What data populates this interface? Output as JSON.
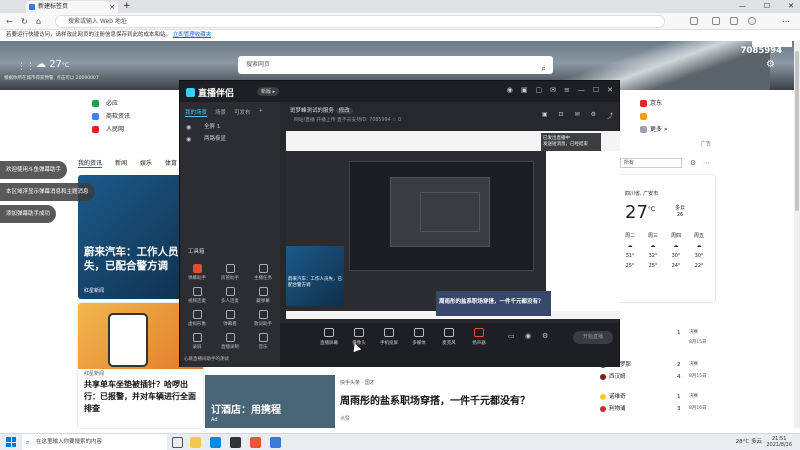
{
  "browser": {
    "tab_title": "新建标签页",
    "url_placeholder": "搜索或输入 Web 地址",
    "info_text": "若要运行快捷访问，请样改此网页的注册信息保存到此的成本和站。",
    "info_link": "立即管理收藏夹"
  },
  "hero": {
    "temp": "27",
    "temp_unit": "°C",
    "weather_sub": "根据你所在城市得获预警, 点击可以 20090007",
    "search_placeholder": "搜索网页",
    "count": "7085994"
  },
  "quick_links_left": [
    {
      "label": "必应",
      "color": "#16a34a"
    },
    {
      "label": "商软资讯",
      "color": "#3b82f6"
    },
    {
      "label": "人民网",
      "color": "#dc2626"
    }
  ],
  "quick_links_right": [
    {
      "label": "京东",
      "color": "#dc2626"
    },
    {
      "label": "",
      "color": "#f59e0b"
    },
    {
      "label": "更多 »",
      "color": "#9ca3af"
    }
  ],
  "ad_tag": "广告",
  "feed": {
    "tabs": [
      "我的资讯",
      "新闻",
      "娱乐",
      "体育"
    ],
    "card1_title": "蔚来汽车：工作人员失，已配合警方调",
    "card1_source": "红星新闻",
    "card2_source": "红星新闻",
    "card2_title": "共享单车坐垫被插针？哈啰出行：已报警，并对车辆进行全面排查",
    "card3_title": "订酒店：用携程",
    "card3_source": "Ad",
    "card4_source": "快手头条 · 国才",
    "card4_title": "周雨彤的盐系职场穿搭，一件千元都没有？",
    "card4_likes": "点赞"
  },
  "toasts": [
    "欢迎使用斗鱼弹幕助手",
    "本区域浮显示弹幕消息和主题消息",
    "添加弹幕助手成功"
  ],
  "weather_widget": {
    "location": "四川省, 广安市",
    "temp": "27",
    "unit": "°C",
    "cond": "多云",
    "aqi": "26",
    "forecast": [
      {
        "day": "周二",
        "hi": "31°",
        "lo": "25°"
      },
      {
        "day": "周三",
        "hi": "32°",
        "lo": "25°"
      },
      {
        "day": "周四",
        "hi": "30°",
        "lo": "24°"
      },
      {
        "day": "周五",
        "hi": "30°",
        "lo": "22°"
      }
    ],
    "select": "所有"
  },
  "sports": [
    {
      "team": "",
      "score": "1",
      "meta": "决赛",
      "color": "#3b82f6"
    },
    {
      "team": "",
      "score": "",
      "meta": "8月15日",
      "color": "#9ca3af"
    },
    {
      "team": "巴萨罗那",
      "score": "2",
      "meta": "决赛",
      "color": "#be123c"
    },
    {
      "team": "西汉姆",
      "score": "4",
      "meta": "8月15日",
      "color": "#7f1d1d"
    },
    {
      "team": "诺维奇",
      "score": "1",
      "meta": "决赛",
      "color": "#facc15"
    },
    {
      "team": "利物浦",
      "score": "3",
      "meta": "8月16日",
      "color": "#dc2626"
    }
  ],
  "app": {
    "name": "直播伴侣",
    "version": "新版 ▸",
    "scene_tabs": [
      "我的场景",
      "场景",
      "可发布"
    ],
    "scenes": [
      "全屏 1",
      "两路极显"
    ],
    "tools_label": "工具箱",
    "tools": [
      "弹幕助手",
      "房管助手",
      "主播任务",
      "视频连麦",
      "多人连麦",
      "藏弹幕",
      "虚拟形象",
      "弹幕看",
      "歌词助手",
      "录屏",
      "直播录制",
      "音乐"
    ],
    "left_footer": "心跳直播间助手的测试",
    "stream_name": "斑梦峰测试的服务",
    "stream_tag": "修改",
    "stream_meta": "网站/直播    开播上传    直不去支持ID: 7085994    ☆ 0",
    "preview_toast_1": "已发出直播中",
    "preview_toast_2": "发送短消息，已经结束",
    "preview_bar": "周雨彤的盐系职场穿搭，一件千元都没有？",
    "preview_ad": "蔚来汽车：工作人员失，已配合警方调",
    "bottom_buttons": [
      "直播屏幕",
      "摄像头",
      "手机投屏",
      "多媒体",
      "麦克风",
      "扬声器"
    ],
    "start_button": "开始直播"
  },
  "taskbar": {
    "search": "在这里输入你要搜索的内容",
    "tray": "28°C 多云",
    "time": "21:51",
    "date": "2021/8/16"
  }
}
